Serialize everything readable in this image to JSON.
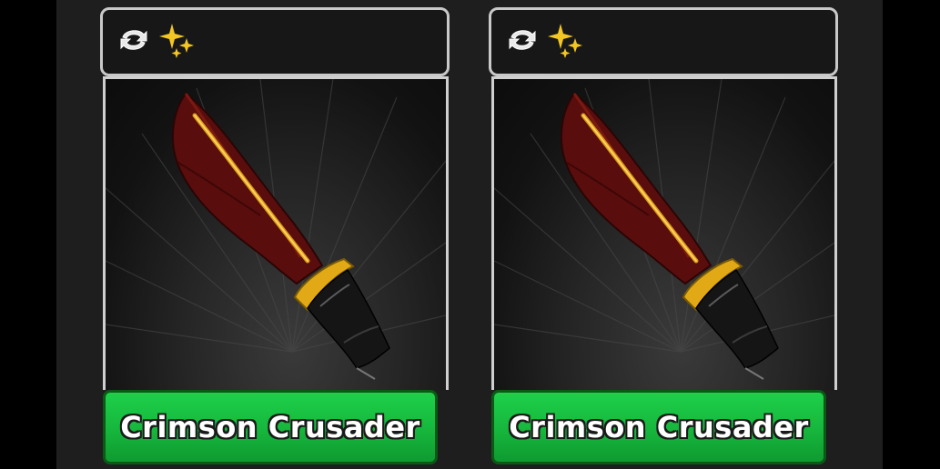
{
  "cards": [
    {
      "item_name": "Crimson Crusader",
      "badges": [
        "trade-icon",
        "sparkle-icon"
      ],
      "rarity_color": "#16b63c"
    },
    {
      "item_name": "Crimson Crusader",
      "badges": [
        "trade-icon",
        "sparkle-icon"
      ],
      "rarity_color": "#16b63c"
    }
  ],
  "colors": {
    "blade": "#5a0d0d",
    "guard": "#e0a915",
    "handle": "#111111",
    "panel": "#1e1e1e"
  }
}
